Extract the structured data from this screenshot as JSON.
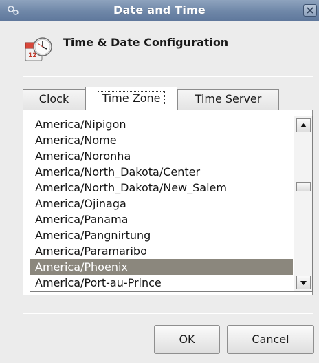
{
  "window": {
    "title": "Date and Time"
  },
  "header": {
    "title": "Time & Date Configuration"
  },
  "tabs": [
    {
      "label": "Clock",
      "active": false
    },
    {
      "label": "Time Zone",
      "active": true
    },
    {
      "label": "Time Server",
      "active": false
    }
  ],
  "timezones": [
    "America/Nipigon",
    "America/Nome",
    "America/Noronha",
    "America/North_Dakota/Center",
    "America/North_Dakota/New_Salem",
    "America/Ojinaga",
    "America/Panama",
    "America/Pangnirtung",
    "America/Paramaribo",
    "America/Phoenix",
    "America/Port-au-Prince"
  ],
  "selected_timezone": "America/Phoenix",
  "buttons": {
    "ok": "OK",
    "cancel": "Cancel"
  },
  "colors": {
    "titlebar": "#6f87a8",
    "selection": "#8b877d"
  },
  "icons": {
    "window_menu": "window-menu-icon",
    "close": "close-icon",
    "header": "calendar-clock-icon",
    "scroll_up": "arrow-up-icon",
    "scroll_down": "arrow-down-icon"
  }
}
